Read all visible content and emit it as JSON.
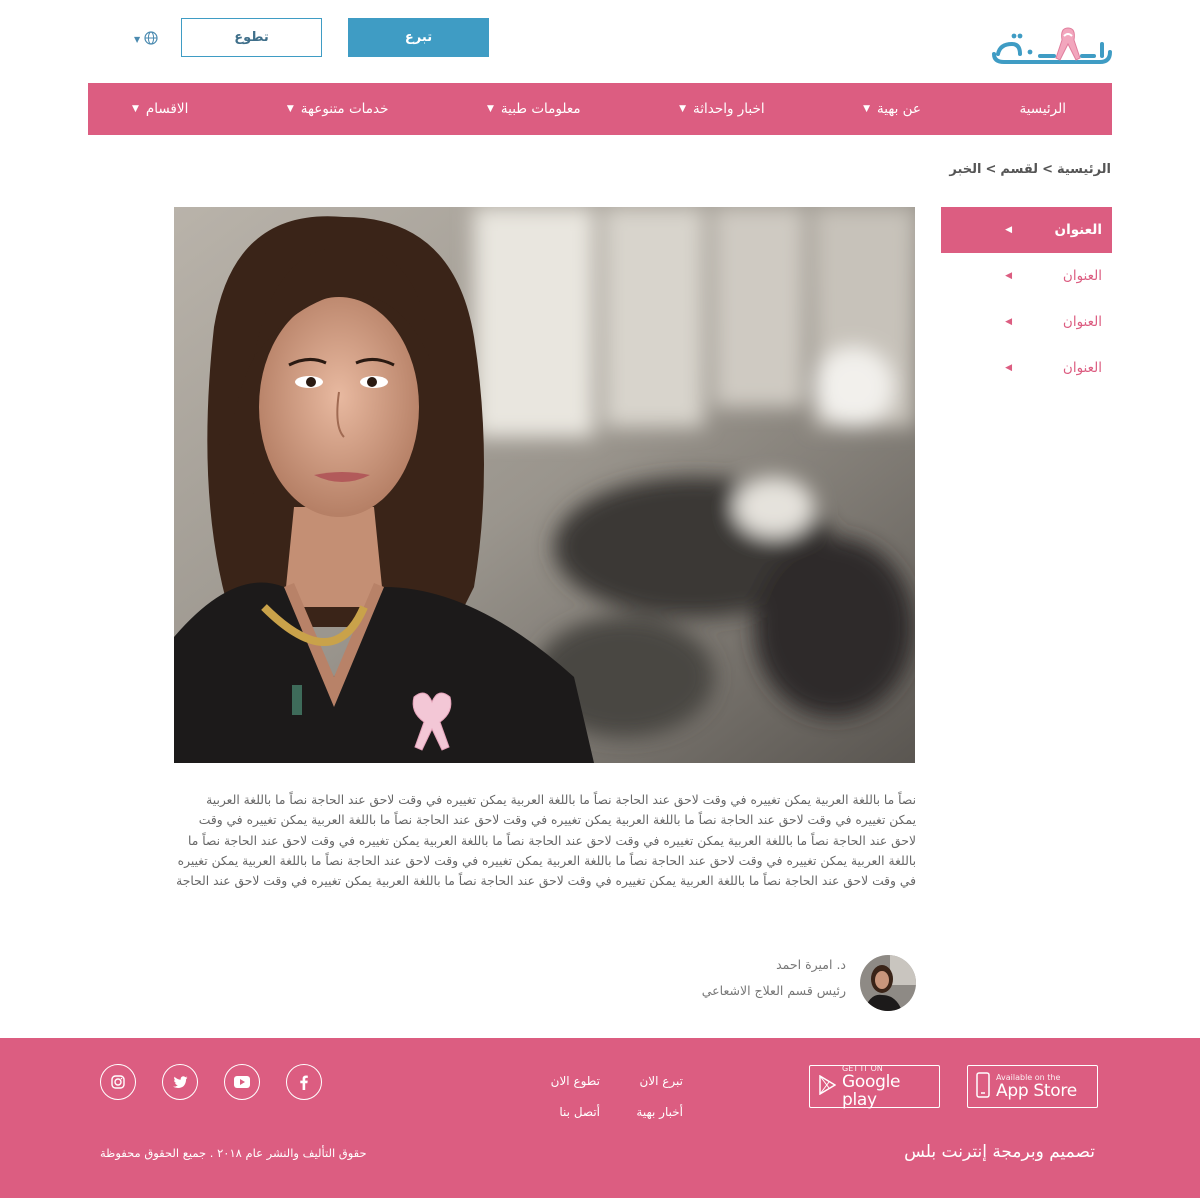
{
  "header": {
    "logo_text": "بهية",
    "donate_label": "تبرع",
    "volunteer_label": "تطوع",
    "language_icon": "globe-icon"
  },
  "nav": {
    "items": [
      {
        "label": "الرئيسية",
        "has_dropdown": false
      },
      {
        "label": "عن بهية",
        "has_dropdown": true
      },
      {
        "label": "اخبار واحداثة",
        "has_dropdown": true
      },
      {
        "label": "معلومات طبية",
        "has_dropdown": true
      },
      {
        "label": "خدمات متنوعهة",
        "has_dropdown": true
      },
      {
        "label": "الاقسام",
        "has_dropdown": true
      }
    ]
  },
  "breadcrumb": {
    "home": "الرئيسية",
    "sep1": ">",
    "section": "لقسم",
    "sep2": ">",
    "current": "الخبر"
  },
  "sidebar": {
    "items": [
      {
        "label": "العنوان",
        "active": true
      },
      {
        "label": "العنوان",
        "active": false
      },
      {
        "label": "العنوان",
        "active": false
      },
      {
        "label": "العنوان",
        "active": false
      }
    ]
  },
  "article": {
    "body": "نصاً ما باللغة العربية يمكن تغييره في وقت لاحق عند الحاجة نصاً ما باللغة العربية يمكن تغييره في وقت لاحق عند الحاجة نصاً ما باللغة العربية يمكن تغييره في وقت لاحق عند الحاجة نصاً ما باللغة العربية يمكن تغييره في وقت لاحق عند الحاجة نصاً ما باللغة العربية يمكن تغييره في وقت لاحق عند الحاجة نصاً ما باللغة العربية يمكن تغييره في وقت لاحق عند الحاجة نصاً ما باللغة العربية يمكن تغييره في وقت لاحق عند الحاجة نصاً ما باللغة العربية يمكن تغييره في وقت لاحق عند الحاجة نصاً ما باللغة العربية يمكن تغييره في وقت لاحق عند الحاجة نصاً ما باللغة العربية يمكن تغييره في وقت لاحق عند الحاجة نصاً ما باللغة العربية يمكن تغييره في وقت لاحق عند الحاجة نصاً ما باللغة العربية يمكن تغييره في وقت لاحق عند الحاجة"
  },
  "author": {
    "name": "د. اميرة احمد",
    "role": "رئيس قسم العلاج الاشعاعي"
  },
  "footer": {
    "app_store_small": "Available on the",
    "app_store_big": "App Store",
    "google_small": "GET IT ON",
    "google_big": "Google play",
    "links_col1": [
      "تبرع الان",
      "أخبار بهية"
    ],
    "links_col2": [
      "تطوع الان",
      "أتصل بنا"
    ],
    "socials": [
      "facebook-icon",
      "youtube-icon",
      "twitter-icon",
      "instagram-icon"
    ],
    "credit": "تصميم وبرمجة إنترنت بلس",
    "copyright": "حقوق التأليف والنشر عام ٢٠١٨ . جميع الحقوق محفوظة"
  },
  "colors": {
    "brand_pink": "#dc5d81",
    "brand_blue": "#3f9cc4"
  }
}
